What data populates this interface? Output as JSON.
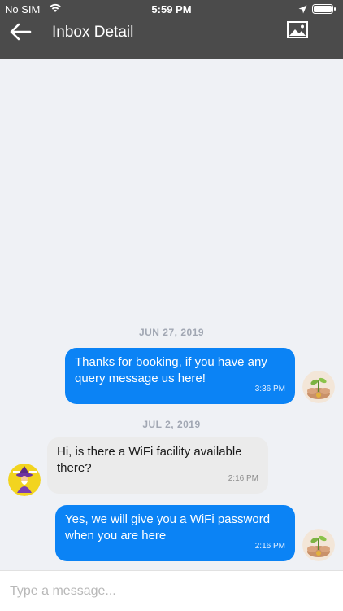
{
  "status_bar": {
    "carrier": "No SIM",
    "time": "5:59 PM"
  },
  "header": {
    "title": "Inbox Detail",
    "back_icon": "arrow-left-icon",
    "image_icon": "image-icon"
  },
  "messages": [
    {
      "date": "JUN 27, 2019"
    },
    {
      "direction": "outgoing",
      "text": "Thanks for booking, if you have any query message us here!",
      "time": "3:36 PM"
    },
    {
      "date": "JUL 2, 2019"
    },
    {
      "direction": "incoming",
      "text": "Hi, is there a WiFi facility available there?",
      "time": "2:16 PM"
    },
    {
      "direction": "outgoing",
      "text": "Yes, we will give you a WiFi password when you are here",
      "time": "2:16 PM"
    }
  ],
  "input": {
    "placeholder": "Type a message..."
  },
  "colors": {
    "header_bg": "#4b4b4b",
    "chat_bg": "#eff1f5",
    "outgoing_bubble": "#0b83f5",
    "incoming_bubble": "#ebebeb"
  }
}
